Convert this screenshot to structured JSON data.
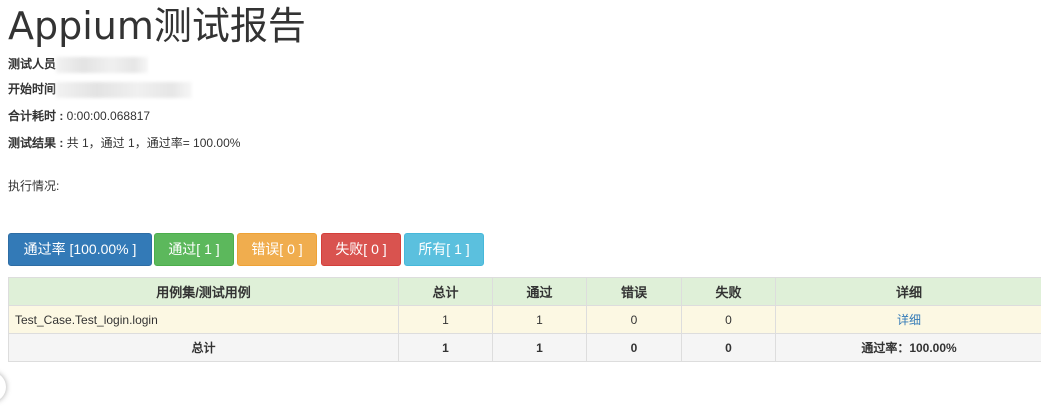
{
  "report": {
    "title": "Appium测试报告",
    "attributes": {
      "tester_label": "测试人员",
      "start_time_label": "开始时间",
      "duration_label": "合计耗时 :",
      "duration_value": " 0:00:00.068817",
      "result_label": "测试结果 :",
      "result_value": " 共 1，通过 1，通过率= 100.00%"
    },
    "execution_label": "执行情况:"
  },
  "filter_buttons": {
    "pass_rate": "通过率 [100.00% ]",
    "passed": "通过[ 1 ]",
    "errors": "错误[ 0 ]",
    "failures": "失败[ 0 ]",
    "all": "所有[ 1 ]"
  },
  "colors": {
    "primary": "#337ab7",
    "success": "#5cb85c",
    "warning": "#f0ad4e",
    "danger": "#d9534f",
    "info": "#5bc0de",
    "header_bg": "#dff0d8",
    "case_row_bg": "#fcf8e3",
    "total_row_bg": "#f5f5f5"
  },
  "table": {
    "headers": [
      "用例集/测试用例",
      "总计",
      "通过",
      "错误",
      "失败",
      "详细"
    ],
    "rows": [
      {
        "name": "Test_Case.Test_login.login",
        "total": "1",
        "passed": "1",
        "errors": "0",
        "failures": "0",
        "detail": "详细"
      }
    ],
    "total_row": {
      "label": "总计",
      "total": "1",
      "passed": "1",
      "errors": "0",
      "failures": "0",
      "rate": "通过率：100.00%"
    }
  }
}
